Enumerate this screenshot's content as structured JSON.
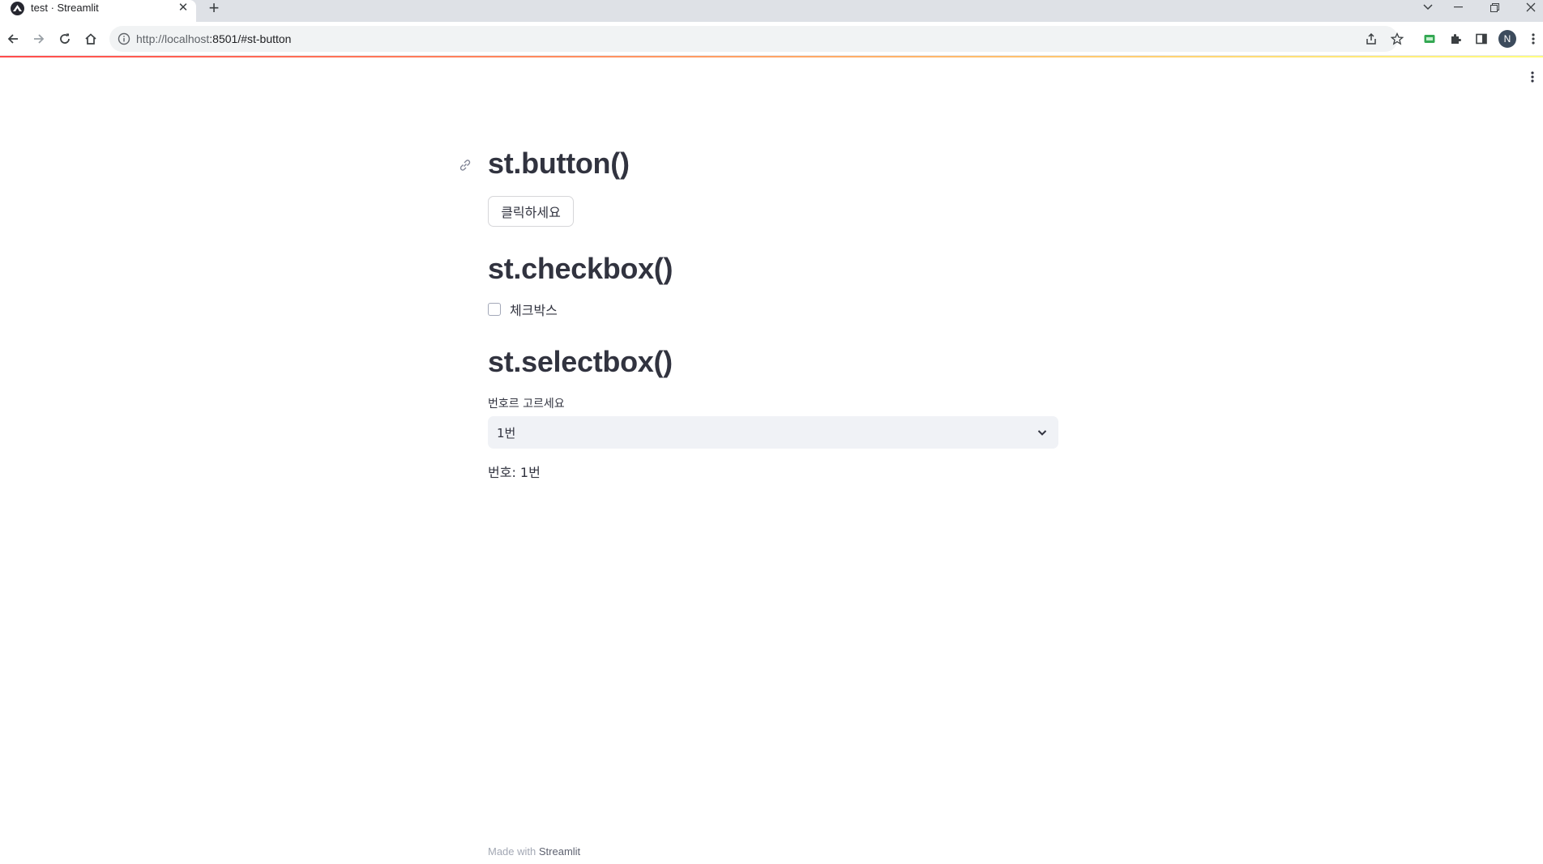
{
  "browser": {
    "tab_title": "test · Streamlit",
    "tab_close_glyph": "✕",
    "new_tab_glyph": "+",
    "url_host": "http://localhost",
    "url_rest": ":8501/#st-button",
    "profile_initial": "N",
    "icons": [
      "back-arrow-icon",
      "forward-arrow-icon",
      "reload-icon",
      "home-icon",
      "site-info-icon",
      "share-icon",
      "bookmark-star-icon",
      "extension-icon",
      "puzzle-icon",
      "side-panel-icon",
      "browser-menu-icon"
    ]
  },
  "app": {
    "sections": {
      "button": {
        "heading": "st.button()",
        "button_label": "클릭하세요"
      },
      "checkbox": {
        "heading": "st.checkbox()",
        "checkbox_label": "체크박스",
        "checked": false
      },
      "selectbox": {
        "heading": "st.selectbox()",
        "label": "번호르 고르세요",
        "selected": "1번",
        "result": "번호: 1번"
      }
    },
    "footer": {
      "prefix": "Made with",
      "brand": "Streamlit"
    },
    "colors": {
      "accent_red": "#ff4b4b",
      "accent_yellow": "#fffd80",
      "text": "#31333f",
      "select_bg": "#f0f2f6"
    }
  }
}
